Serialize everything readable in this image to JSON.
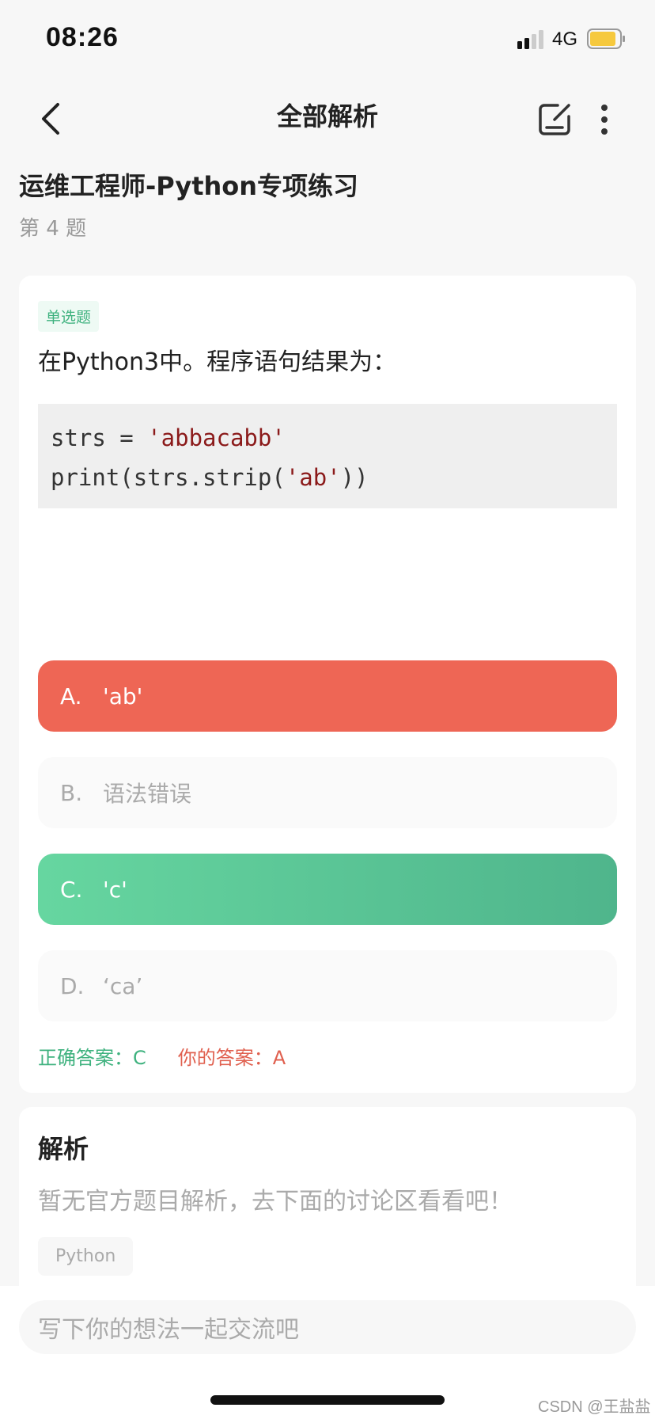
{
  "status_bar": {
    "time": "08:26",
    "network": "4G"
  },
  "nav": {
    "title": "全部解析"
  },
  "practice": {
    "title": "运维工程师-Python专项练习",
    "index": "第 4 题"
  },
  "question": {
    "type": "单选题",
    "stem": "在Python3中。程序语句结果为：",
    "code": [
      {
        "plain": "strs = ",
        "string": "'abbacabb'",
        "tail": ""
      },
      {
        "plain": "print(strs.strip(",
        "string": "'ab'",
        "tail": "))"
      }
    ],
    "options": [
      {
        "letter": "A.",
        "text": "'ab'",
        "state": "wrong"
      },
      {
        "letter": "B.",
        "text": "语法错误",
        "state": "neutral"
      },
      {
        "letter": "C.",
        "text": "'c'",
        "state": "correct"
      },
      {
        "letter": "D.",
        "text": "‘ca’",
        "state": "neutral"
      }
    ],
    "correct_answer": "正确答案：C",
    "your_answer": "你的答案：A"
  },
  "analysis": {
    "title": "解析",
    "text": "暂无官方题目解析，去下面的讨论区看看吧！",
    "tag": "Python"
  },
  "comment": {
    "placeholder": "写下你的想法一起交流吧"
  },
  "watermark": "CSDN @王盐盐",
  "colors": {
    "wrong": "#ee6655",
    "correct": "#4fb58c",
    "tag_green": "#3fb27f"
  }
}
